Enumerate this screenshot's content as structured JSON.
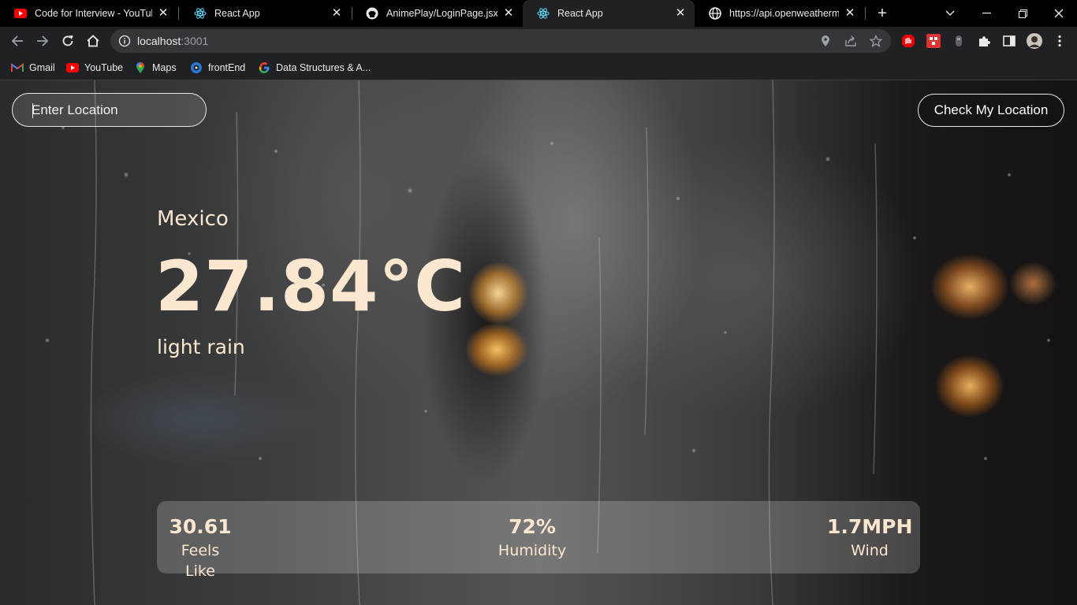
{
  "browser": {
    "tabs": [
      {
        "title": "Code for Interview - YouTube",
        "favicon": "youtube-icon",
        "active": false
      },
      {
        "title": "React App",
        "favicon": "react-icon",
        "active": false
      },
      {
        "title": "AnimePlay/LoginPage.jsx at m",
        "favicon": "github-icon",
        "active": false
      },
      {
        "title": "React App",
        "favicon": "react-icon",
        "active": true
      },
      {
        "title": "https://api.openweathermap.",
        "favicon": "globe-icon",
        "active": false
      }
    ],
    "address": {
      "host": "localhost",
      "port": ":3001"
    },
    "bookmarks": [
      {
        "label": "Gmail",
        "icon": "gmail-icon"
      },
      {
        "label": "YouTube",
        "icon": "youtube-icon"
      },
      {
        "label": "Maps",
        "icon": "maps-icon"
      },
      {
        "label": "frontEnd",
        "icon": "folder-icon"
      },
      {
        "label": "Data Structures & A...",
        "icon": "google-icon"
      }
    ]
  },
  "app": {
    "search": {
      "placeholder": "Enter Location",
      "value": ""
    },
    "check_location_label": "Check My Location",
    "location": "Mexico",
    "temperature": "27.84°C",
    "description": "light rain",
    "stats": {
      "feels_like": {
        "value": "30.61",
        "label": "Feels Like"
      },
      "humidity": {
        "value": "72%",
        "label": "Humidity"
      },
      "wind": {
        "value": "1.7MPH",
        "label": "Wind"
      }
    }
  },
  "colors": {
    "accent_text": "#fbe7cf",
    "browser_chrome": "#202124",
    "tab_strip": "#000000"
  }
}
